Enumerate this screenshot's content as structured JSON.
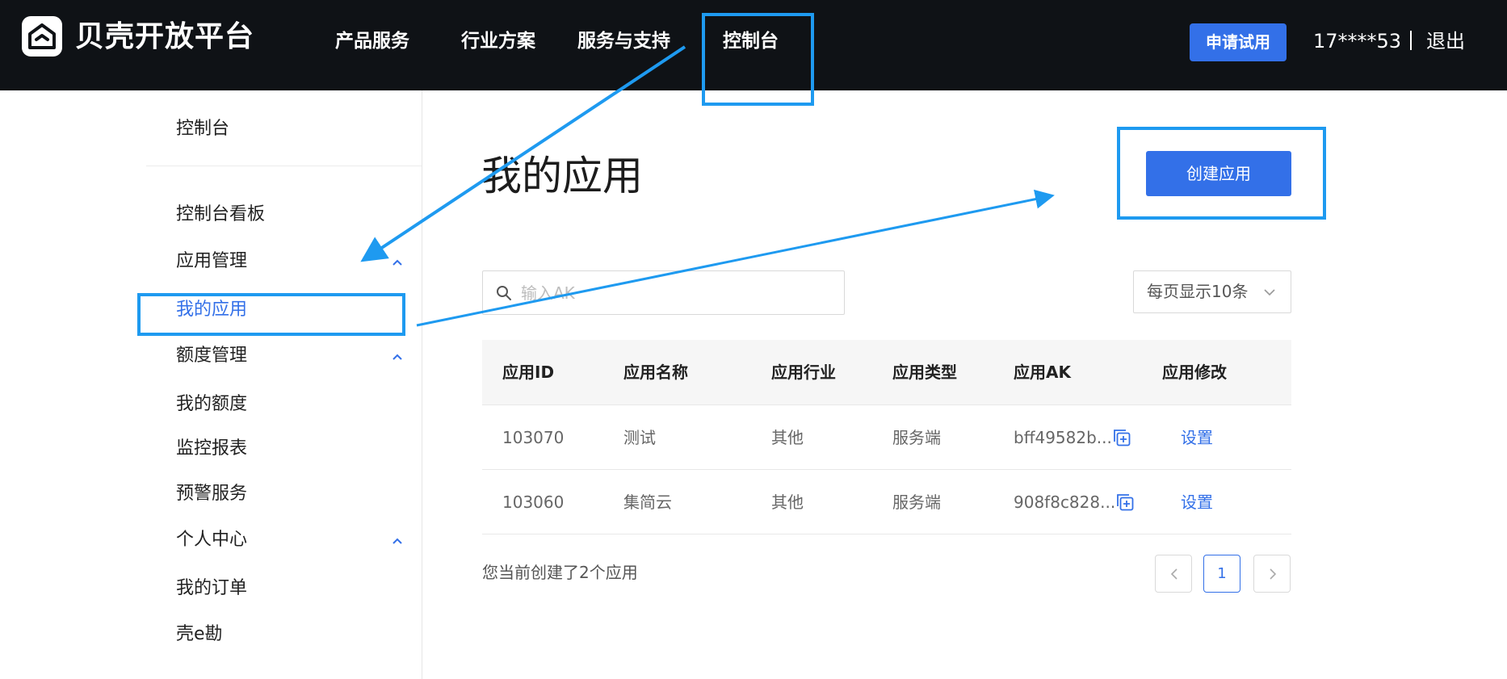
{
  "header": {
    "brand": "贝壳开放平台",
    "nav": [
      "产品服务",
      "行业方案",
      "服务与支持",
      "控制台"
    ],
    "trial_button": "申请试用",
    "user_id": "17****53",
    "logout": "退出"
  },
  "sidebar": {
    "top_item": "控制台",
    "items": [
      {
        "label": "控制台看板"
      },
      {
        "label": "应用管理",
        "expanded": true
      },
      {
        "label": "我的应用",
        "active": true
      },
      {
        "label": "额度管理",
        "expanded": true
      },
      {
        "label": "我的额度"
      },
      {
        "label": "监控报表"
      },
      {
        "label": "预警服务"
      },
      {
        "label": "个人中心",
        "expanded": true
      },
      {
        "label": "我的订单"
      },
      {
        "label": "壳e勘"
      }
    ]
  },
  "main": {
    "title": "我的应用",
    "create_button": "创建应用",
    "search_placeholder": "输入AK",
    "page_size": "每页显示10条",
    "table": {
      "headers": [
        "应用ID",
        "应用名称",
        "应用行业",
        "应用类型",
        "应用AK",
        "应用修改"
      ],
      "rows": [
        {
          "id": "103070",
          "name": "测试",
          "industry": "其他",
          "type": "服务端",
          "ak": "bff49582b...",
          "action": "设置"
        },
        {
          "id": "103060",
          "name": "集简云",
          "industry": "其他",
          "type": "服务端",
          "ak": "908f8c828...",
          "action": "设置"
        }
      ]
    },
    "summary": "您当前创建了2个应用",
    "pagination": {
      "current": "1"
    }
  },
  "theme": {
    "accent": "#3370e8",
    "topbar_bg": "#0f1216",
    "annotation": "#1e9af0"
  },
  "icons": [
    "logo-icon",
    "search-icon",
    "chevron-down-icon",
    "chevron-up-icon",
    "copy-icon",
    "chevron-left-icon",
    "chevron-right-icon"
  ]
}
